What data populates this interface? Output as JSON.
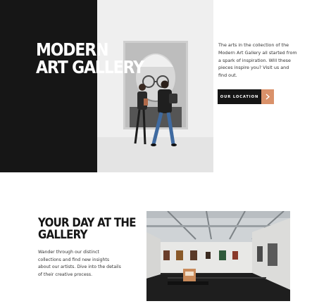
{
  "hero": {
    "title_line1": "MODERN",
    "title_line2": "ART GALLERY",
    "description": "The arts in the collection of the Modern Art Gallery all started from a spark of inspiration. Will these pieces inspire you? Visit us and find out.",
    "cta_label": "OUR LOCATION",
    "cta_icon": "chevron-right-icon"
  },
  "section2": {
    "title_line1": "YOUR DAY AT THE",
    "title_line2": "GALLERY",
    "description": "Wander through our distinct collections and find new insights about our artists. Dive into the details of their creative process."
  },
  "colors": {
    "dark_panel": "#161616",
    "accent": "#d9916a",
    "text": "#333333"
  }
}
